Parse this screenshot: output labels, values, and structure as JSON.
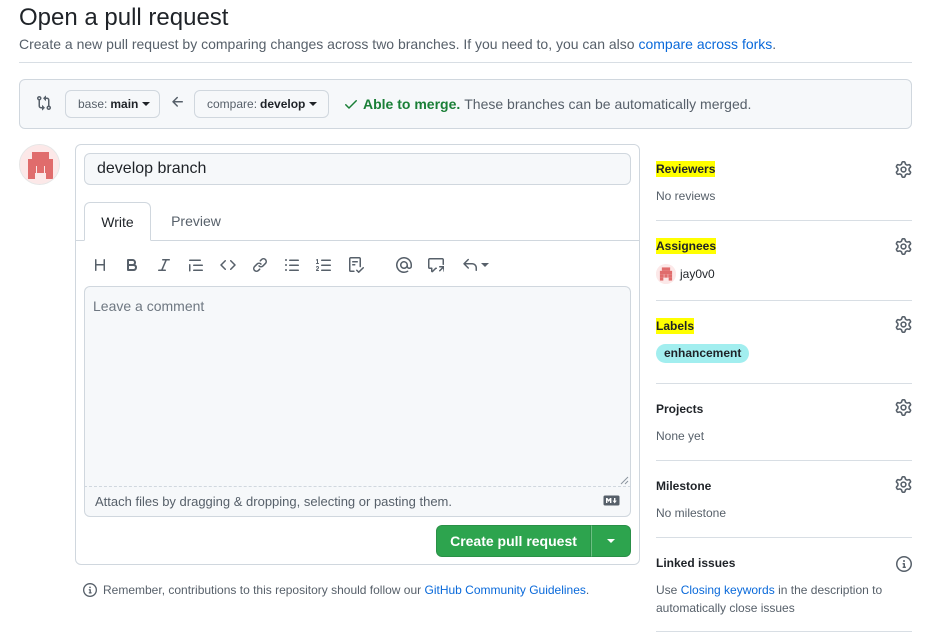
{
  "header": {
    "title": "Open a pull request",
    "subtitle": "Create a new pull request by comparing changes across two branches. If you need to, you can also",
    "subtitle_link": "compare across forks",
    "subtitle_end": "."
  },
  "range": {
    "base_label": "base:",
    "base_value": "main",
    "compare_label": "compare:",
    "compare_value": "develop",
    "merge_status": "Able to merge.",
    "merge_text": "These branches can be automatically merged."
  },
  "form": {
    "title_value": "develop branch",
    "tabs": [
      "Write",
      "Preview"
    ],
    "comment_placeholder": "Leave a comment",
    "attach_text": "Attach files by dragging & dropping, selecting or pasting them.",
    "submit_label": "Create pull request"
  },
  "toolbar": {
    "icons": [
      "heading-icon",
      "bold-icon",
      "italic-icon",
      "quote-icon",
      "code-icon",
      "link-icon",
      "unordered-list-icon",
      "ordered-list-icon",
      "task-list-icon",
      "mention-icon",
      "reference-icon",
      "reply-icon"
    ]
  },
  "note": {
    "text": "Remember, contributions to this repository should follow our",
    "link": "GitHub Community Guidelines",
    "end": "."
  },
  "sidebar": {
    "reviewers": {
      "heading": "Reviewers",
      "value": "No reviews"
    },
    "assignees": {
      "heading": "Assignees",
      "value": "jay0v0"
    },
    "labels": {
      "heading": "Labels",
      "value": "enhancement",
      "color": "#a2eeef"
    },
    "projects": {
      "heading": "Projects",
      "value": "None yet"
    },
    "milestone": {
      "heading": "Milestone",
      "value": "No milestone"
    },
    "linked_issues": {
      "heading": "Linked issues",
      "text_before": "Use",
      "link": "Closing keywords",
      "text_after": "in the description to",
      "line2": "automatically close issues"
    }
  },
  "colors": {
    "accent": "#0969da",
    "success": "#1a7f37",
    "primary_button": "#2da44e",
    "highlight": "#ffff00"
  }
}
